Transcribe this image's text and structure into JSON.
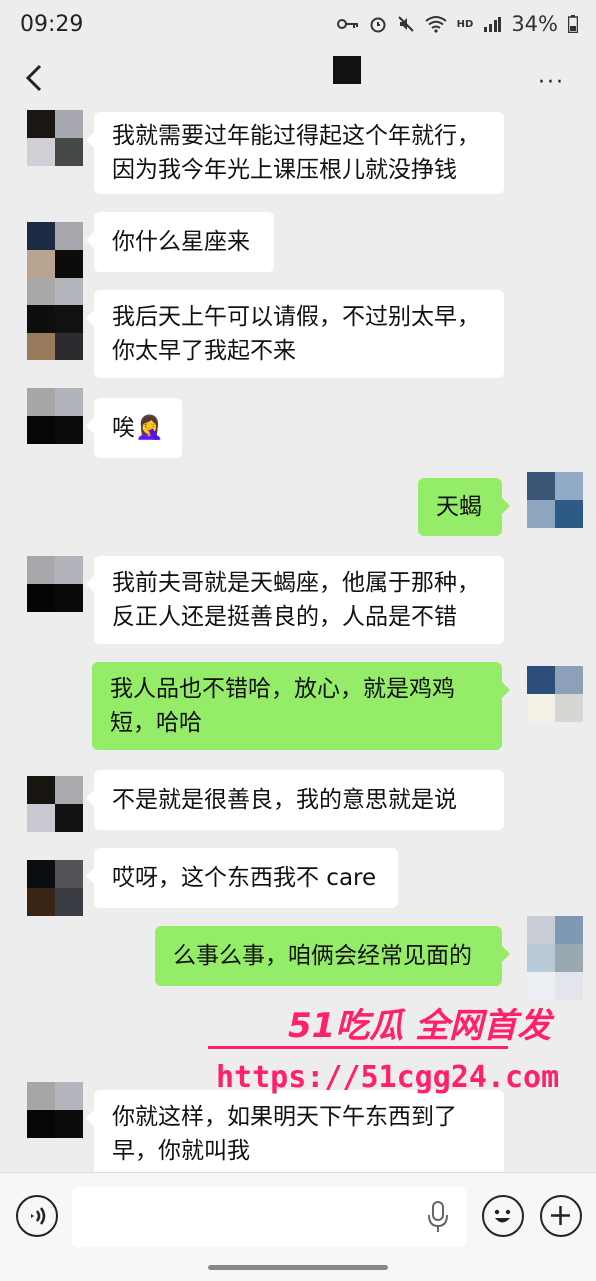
{
  "status_bar": {
    "time": "09:29",
    "network": "HD",
    "battery": "34%"
  },
  "nav": {
    "back_icon": "chevron-left-icon",
    "more": "···"
  },
  "messages": [
    {
      "side": "left",
      "lines": [
        "我就需要过年能过得起这个年就行，",
        "因为我今年光上课压根儿就没挣钱"
      ]
    },
    {
      "side": "left",
      "lines": [
        "你什么星座来"
      ]
    },
    {
      "side": "left",
      "lines": [
        "我后天上午可以请假，不过别太早，",
        "你太早了我起不来"
      ]
    },
    {
      "side": "left",
      "lines": [
        "唉🤦‍♀️"
      ]
    },
    {
      "side": "right",
      "lines": [
        "天蝎"
      ]
    },
    {
      "side": "left",
      "lines": [
        "我前夫哥就是天蝎座，他属于那种，",
        "反正人还是挺善良的，人品是不错"
      ]
    },
    {
      "side": "right",
      "lines": [
        "我人品也不错哈，放心，就是鸡鸡",
        "短，哈哈"
      ]
    },
    {
      "side": "left",
      "lines": [
        "不是就是很善良，我的意思就是说"
      ]
    },
    {
      "side": "left",
      "lines": [
        "哎呀，这个东西我不 care"
      ]
    },
    {
      "side": "right",
      "lines": [
        "么事么事，咱俩会经常见面的"
      ]
    },
    {
      "side": "left",
      "lines": [
        "你就这样，如果明天下午东西到了",
        "早，你就叫我"
      ]
    }
  ],
  "watermark": {
    "top": "51吃瓜 全网首发",
    "url": "https://51cgg24.com"
  },
  "colors": {
    "background": "#ededed",
    "bubble_left": "#ffffff",
    "bubble_right": "#95ec69",
    "watermark": "#ff1f6b"
  },
  "input_bar": {
    "voice_icon": "voice-icon",
    "mic_icon": "mic-icon",
    "emoji_icon": "emoji-icon",
    "plus_icon": "plus-icon"
  }
}
